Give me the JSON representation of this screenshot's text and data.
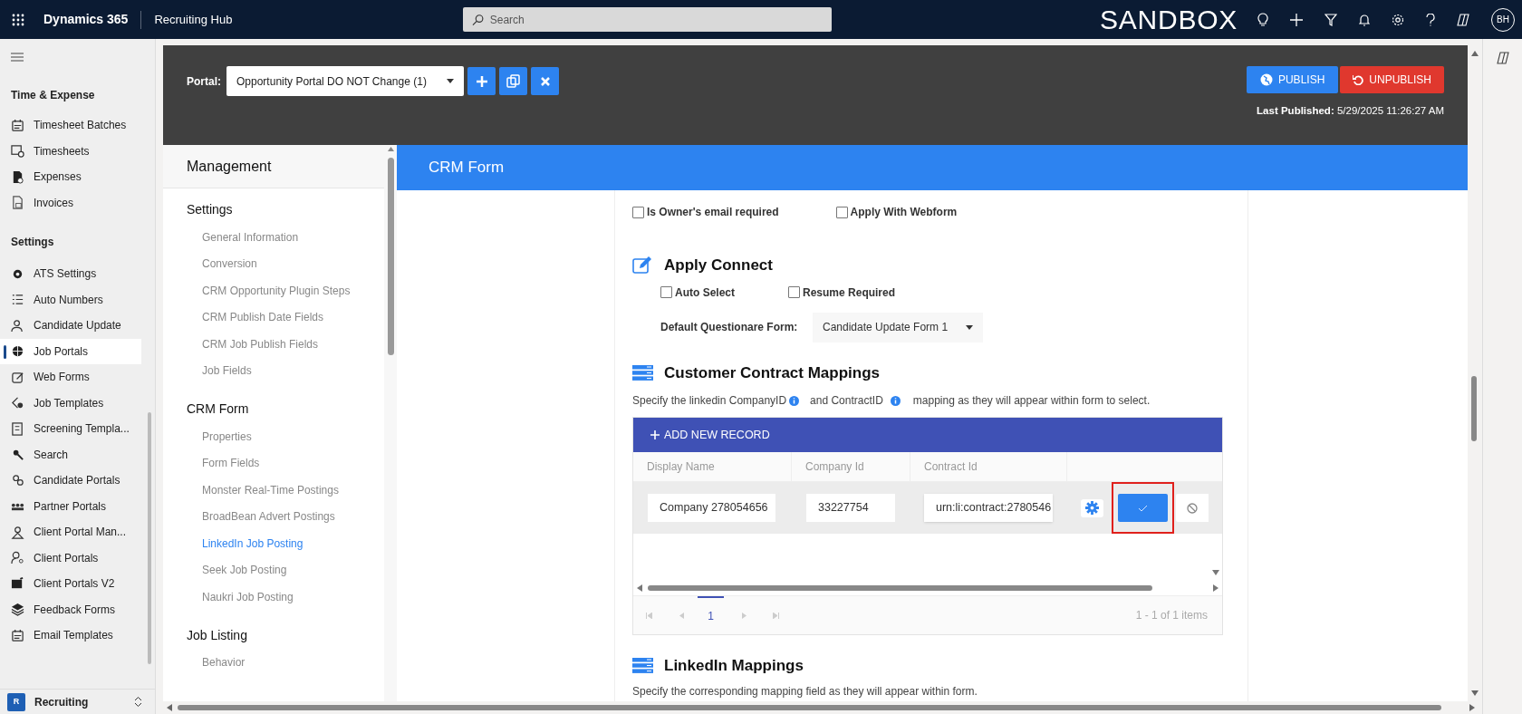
{
  "top_bar": {
    "app_name": "Dynamics 365",
    "area": "Recruiting Hub",
    "search_placeholder": "Search",
    "environment": "SANDBOX",
    "avatar_initials": "BH"
  },
  "nav": {
    "sections": [
      {
        "title": "Time & Expense",
        "items": [
          {
            "label": "Timesheet Batches",
            "selected": false
          },
          {
            "label": "Timesheets",
            "selected": false
          },
          {
            "label": "Expenses",
            "selected": false
          },
          {
            "label": "Invoices",
            "selected": false
          }
        ]
      },
      {
        "title": "Settings",
        "items": [
          {
            "label": "ATS Settings",
            "selected": false
          },
          {
            "label": "Auto Numbers",
            "selected": false
          },
          {
            "label": "Candidate Update",
            "selected": false
          },
          {
            "label": "Job Portals",
            "selected": true
          },
          {
            "label": "Web Forms",
            "selected": false
          },
          {
            "label": "Job Templates",
            "selected": false
          },
          {
            "label": "Screening Templa...",
            "selected": false
          },
          {
            "label": "Search",
            "selected": false
          },
          {
            "label": "Candidate Portals",
            "selected": false
          },
          {
            "label": "Partner Portals",
            "selected": false
          },
          {
            "label": "Client Portal Man...",
            "selected": false
          },
          {
            "label": "Client Portals",
            "selected": false
          },
          {
            "label": "Client Portals V2",
            "selected": false
          },
          {
            "label": "Feedback Forms",
            "selected": false
          },
          {
            "label": "Email Templates",
            "selected": false
          }
        ]
      }
    ],
    "area_switcher": {
      "badge": "R",
      "label": "Recruiting"
    }
  },
  "portal_bar": {
    "label": "Portal:",
    "selected_portal": "Opportunity Portal DO NOT Change (1)",
    "publish": "PUBLISH",
    "unpublish": "UNPUBLISH",
    "last_published_label": "Last Published:",
    "last_published": "5/29/2025 11:26:27 AM"
  },
  "management": {
    "title": "Management",
    "groups": [
      {
        "title": "Settings",
        "items": [
          {
            "label": "General Information",
            "selected": false
          },
          {
            "label": "Conversion",
            "selected": false
          },
          {
            "label": "CRM Opportunity Plugin Steps",
            "selected": false
          },
          {
            "label": "CRM Publish Date Fields",
            "selected": false
          },
          {
            "label": "CRM Job Publish Fields",
            "selected": false
          },
          {
            "label": "Job Fields",
            "selected": false
          }
        ]
      },
      {
        "title": "CRM Form",
        "items": [
          {
            "label": "Properties",
            "selected": false
          },
          {
            "label": "Form Fields",
            "selected": false
          },
          {
            "label": "Monster Real-Time Postings",
            "selected": false
          },
          {
            "label": "BroadBean Advert Postings",
            "selected": false
          },
          {
            "label": "LinkedIn Job Posting",
            "selected": true
          },
          {
            "label": "Seek Job Posting",
            "selected": false
          },
          {
            "label": "Naukri Job Posting",
            "selected": false
          }
        ]
      },
      {
        "title": "Job Listing",
        "items": [
          {
            "label": "Behavior",
            "selected": false
          }
        ]
      }
    ]
  },
  "content_title": "CRM Form",
  "form": {
    "top_checkboxes": [
      {
        "label": "Is Owner's email required",
        "checked": false
      },
      {
        "label": "Apply With Webform",
        "checked": false
      }
    ],
    "apply_connect": {
      "title": "Apply Connect",
      "checkboxes": [
        {
          "label": "Auto Select",
          "checked": false
        },
        {
          "label": "Resume Required",
          "checked": false
        }
      ],
      "default_form_label": "Default Questionare Form:",
      "default_form_value": "Candidate Update Form 1"
    },
    "contract_mappings": {
      "title": "Customer Contract Mappings",
      "description": [
        "Specify the linkedin CompanyID",
        "and ContractID",
        "mapping as they will appear within form to select."
      ],
      "add_button": "ADD NEW RECORD",
      "columns": [
        "Display Name",
        "Company Id",
        "Contract Id"
      ],
      "rows": [
        {
          "display_name": "Company 278054656",
          "company_id": "33227754",
          "contract_id": "urn:li:contract:2780546"
        }
      ],
      "pager": {
        "page": "1",
        "summary": "1 - 1 of 1 items"
      }
    },
    "linkedin_mappings": {
      "title": "LinkedIn Mappings",
      "description": "Specify the corresponding mapping field as they will appear within form."
    }
  }
}
